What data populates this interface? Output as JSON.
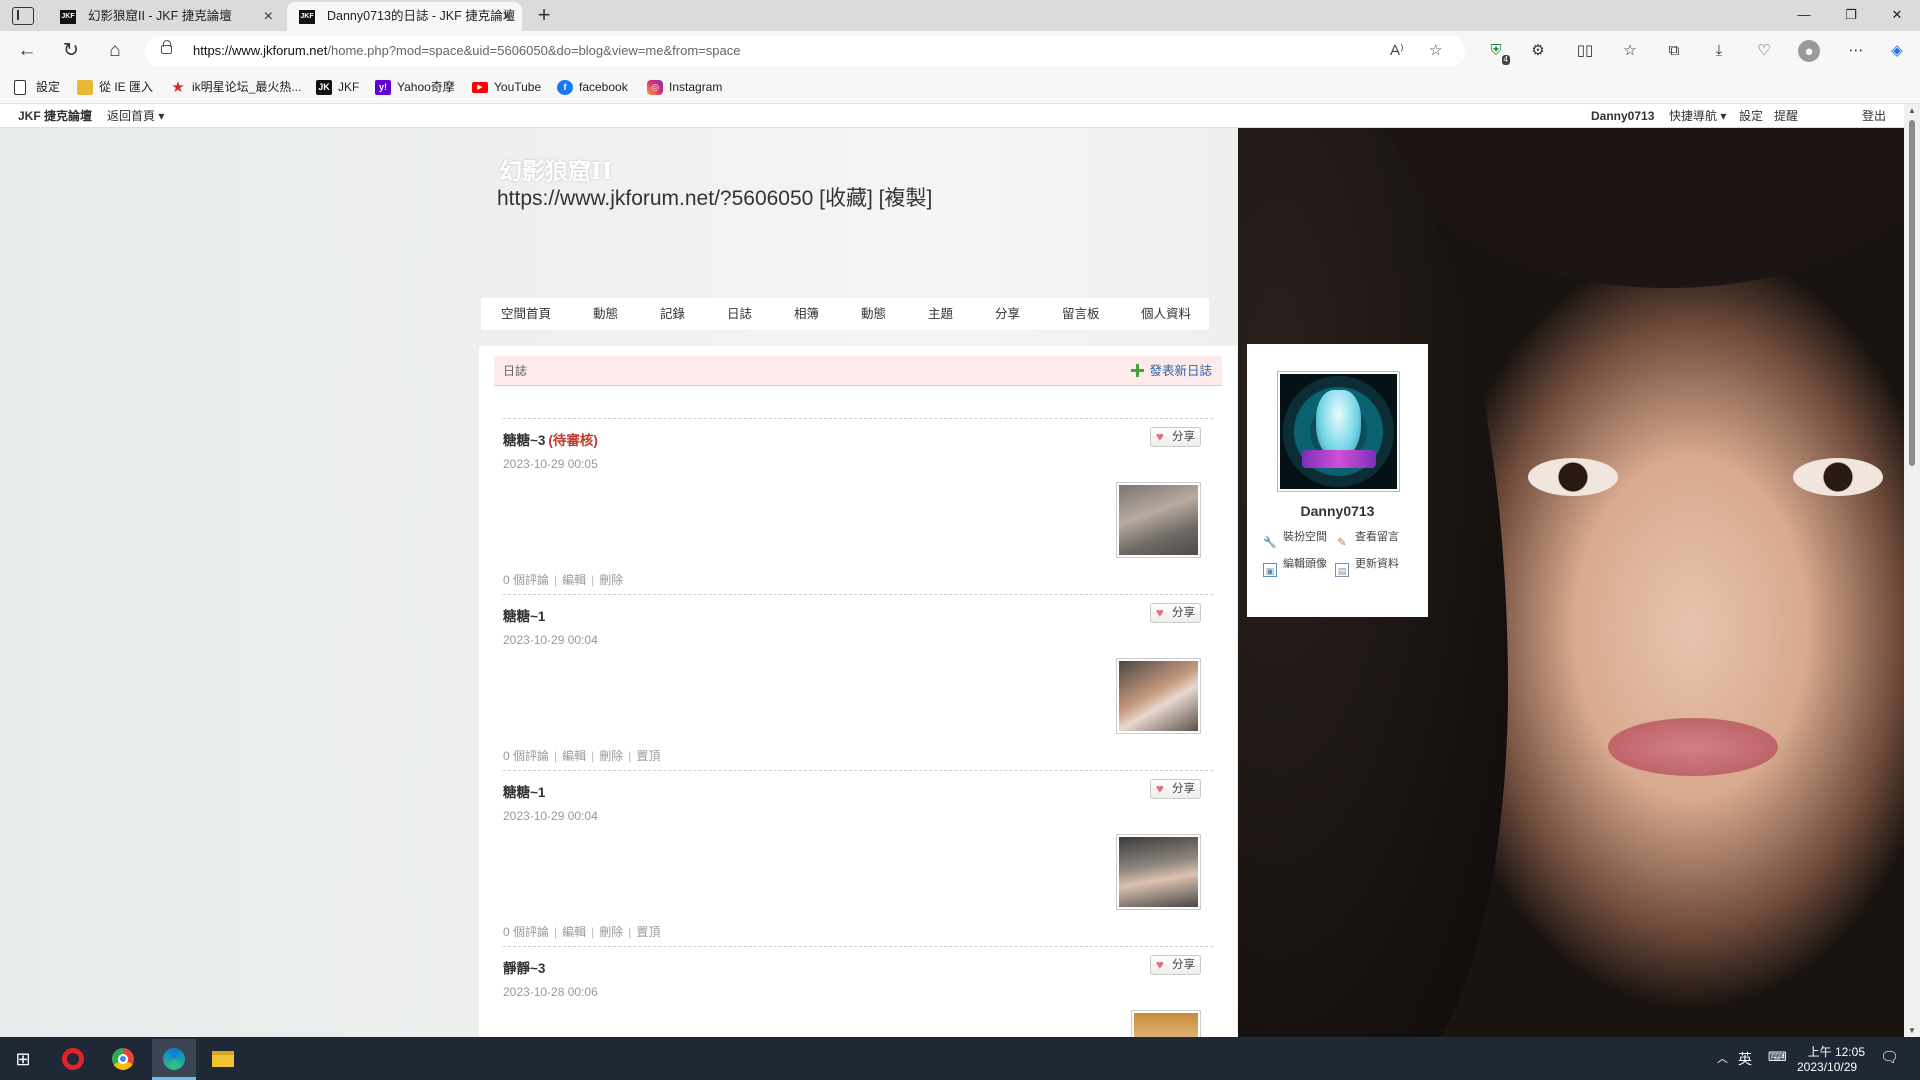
{
  "browser": {
    "tabs": [
      {
        "title": "幻影狼窟II - JKF 捷克論壇",
        "active": false
      },
      {
        "title": "Danny0713的日誌 - JKF 捷克論壇",
        "active": true
      }
    ],
    "tab_favicon": "JKF",
    "url_host": "https://www.jkforum.net",
    "url_path": "/home.php?mod=space&uid=5606050&do=blog&view=me&from=space",
    "read_aloud": "A⁾",
    "ext_badge": "4"
  },
  "bookmarks": [
    {
      "label": "設定",
      "icon": "page-icon"
    },
    {
      "label": "從 IE 匯入",
      "icon": "folder-icon"
    },
    {
      "label": "ik明星论坛_最火热...",
      "icon": "star-icon"
    },
    {
      "label": "JKF",
      "icon": "jkf-icon"
    },
    {
      "label": "Yahoo奇摩",
      "icon": "yahoo-icon"
    },
    {
      "label": "YouTube",
      "icon": "youtube-icon"
    },
    {
      "label": "facebook",
      "icon": "facebook-icon"
    },
    {
      "label": "Instagram",
      "icon": "instagram-icon"
    }
  ],
  "topbar": {
    "site": "JKF 捷克論壇",
    "home": "返回首頁",
    "user": "Danny0713",
    "quick": "快捷導航",
    "settings": "設定",
    "remind": "提醒",
    "logout": "登出"
  },
  "space": {
    "title": "幻影狼窟II",
    "url_line": "https://www.jkforum.net/?5606050 [收藏] [複製]",
    "nav": [
      "空間首頁",
      "動態",
      "記錄",
      "日誌",
      "相簿",
      "動態",
      "主題",
      "分享",
      "留言板",
      "個人資料"
    ]
  },
  "blog": {
    "header": "日誌",
    "new_post": "發表新日誌",
    "share_label": "分享",
    "posts": [
      {
        "title": "糖糖~3",
        "pending": "(待審核)",
        "date": "2023-10-29 00:05",
        "comments": "0 個評論",
        "edit": "編輯",
        "delete": "刪除",
        "pin": ""
      },
      {
        "title": "糖糖~1",
        "pending": "",
        "date": "2023-10-29 00:04",
        "comments": "0 個評論",
        "edit": "編輯",
        "delete": "刪除",
        "pin": "置頂"
      },
      {
        "title": "糖糖~1",
        "pending": "",
        "date": "2023-10-29 00:04",
        "comments": "0 個評論",
        "edit": "編輯",
        "delete": "刪除",
        "pin": "置頂"
      },
      {
        "title": "靜靜~3",
        "pending": "",
        "date": "2023-10-28 00:06",
        "comments": "",
        "edit": "",
        "delete": "",
        "pin": ""
      }
    ]
  },
  "profile": {
    "name": "Danny0713",
    "links": [
      "裝扮空間",
      "查看留言",
      "編輯頭像",
      "更新資料"
    ]
  },
  "taskbar": {
    "ime": "英",
    "time": "上午 12:05",
    "date": "2023/10/29"
  }
}
